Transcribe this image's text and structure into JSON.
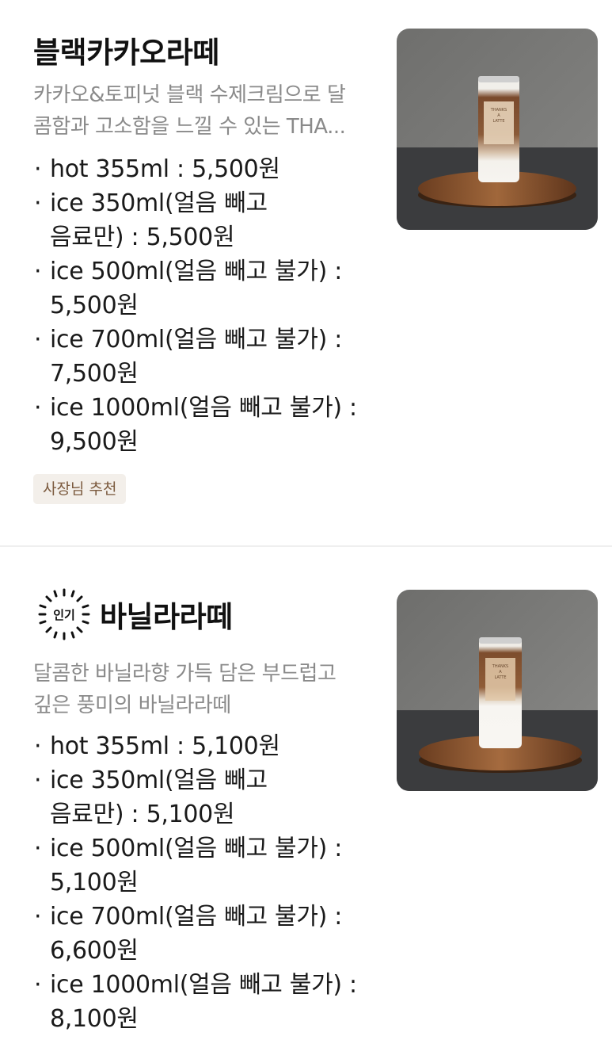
{
  "items": [
    {
      "name": "블랙카카오라떼",
      "description_lines": [
        "카카오&토피넛 블랙 수제크림으로 달",
        "콤함과 고소함을 느낄 수 있는 THA..."
      ],
      "options": [
        {
          "lines": [
            "hot 355ml : 5,500원"
          ]
        },
        {
          "lines": [
            "ice 350ml(얼음 빼고",
            "음료만) : 5,500원"
          ]
        },
        {
          "lines": [
            "ice 500ml(얼음 빼고 불가) :",
            "5,500원"
          ]
        },
        {
          "lines": [
            "ice 700ml(얼음 빼고 불가) :",
            "7,500원"
          ]
        },
        {
          "lines": [
            "ice 1000ml(얼음 빼고 불가) :",
            "9,500원"
          ]
        }
      ],
      "badge": "사장님 추천",
      "photo": {
        "label_text": "THANKS A LATTE",
        "drink": "black-cacao-latte"
      }
    },
    {
      "name": "바닐라라떼",
      "popular_badge": "인기",
      "description_lines": [
        "달콤한 바닐라향 가득 담은 부드럽고",
        "깊은 풍미의 바닐라라떼"
      ],
      "options": [
        {
          "lines": [
            "hot 355ml : 5,100원"
          ]
        },
        {
          "lines": [
            "ice 350ml(얼음 빼고",
            "음료만) : 5,100원"
          ]
        },
        {
          "lines": [
            "ice 500ml(얼음 빼고 불가) :",
            "5,100원"
          ]
        },
        {
          "lines": [
            "ice 700ml(얼음 빼고 불가) :",
            "6,600원"
          ]
        },
        {
          "lines": [
            "ice 1000ml(얼음 빼고 불가) :",
            "8,100원"
          ]
        }
      ],
      "photo": {
        "label_text": "THANKS A LATTE",
        "drink": "vanilla-latte"
      }
    }
  ],
  "colors": {
    "badge_bg": "#f3efea",
    "badge_text": "#7b5a3e",
    "desc_text": "#8a8a8a",
    "divider": "#efefef"
  }
}
